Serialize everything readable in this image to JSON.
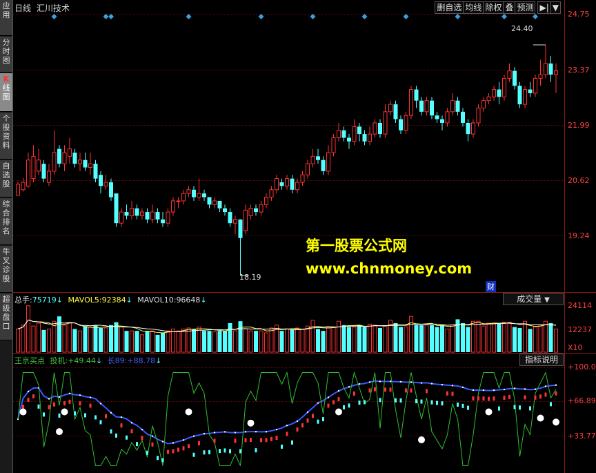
{
  "sidebar": {
    "items": [
      {
        "label": "应用"
      },
      {
        "label": "分时图"
      },
      {
        "label_k": "K",
        "label": "线图"
      },
      {
        "label": "个股资料"
      },
      {
        "label": "自选股"
      },
      {
        "label": "综合排名"
      },
      {
        "label": "牛叉诊股"
      },
      {
        "label": "超级盘口"
      }
    ]
  },
  "topbar": {
    "period": "日线",
    "indicator": "汇川技术",
    "buttons": [
      "删自选",
      "均线",
      "除权",
      "叠",
      "预测"
    ],
    "nav_icon": "▶|",
    "dropdown_icon": "▼"
  },
  "price_axis": {
    "labels": [
      "24.75",
      "23.37",
      "21.99",
      "20.62",
      "19.24"
    ]
  },
  "annotations": {
    "high": "24.40",
    "low": "18.19",
    "finance_badge": "财"
  },
  "watermark": {
    "line1": "第一股票公式网",
    "line2": "www.chnmoney.com"
  },
  "volume": {
    "label_total": "总手:",
    "total": "75719",
    "label_ma5": "MAVOL5:",
    "ma5": "92384",
    "label_ma10": "MAVOL10:",
    "ma10": "96648",
    "arrow": "↓",
    "selector": "成交量",
    "axis": [
      "24114",
      "12237"
    ],
    "multiplier": "X10"
  },
  "indicator": {
    "name": "王京买点",
    "label_tj": "投机:",
    "tj": "+49.44",
    "label_ch": "长89:",
    "ch": "+88.78",
    "arrow": "↓",
    "help_button": "指标说明",
    "axis": [
      "+100.0",
      "+66.89",
      "+33.77"
    ]
  },
  "colors": {
    "up": "#ff3232",
    "down": "#54ffff",
    "axis": "#ff4040",
    "watermark": "#ffff00",
    "marker": "#3aa0d8"
  },
  "chart_data": {
    "type": "candlestick",
    "ylim": [
      17.8,
      25.2
    ],
    "candles_ohlc": [
      [
        20.35,
        20.65,
        20.55,
        20.72
      ],
      [
        20.5,
        20.7,
        20.45,
        20.82
      ],
      [
        20.6,
        21.3,
        20.55,
        21.5
      ],
      [
        20.8,
        21.4,
        20.7,
        21.7
      ],
      [
        21.0,
        21.3,
        20.9,
        21.6
      ],
      [
        21.2,
        20.8,
        20.7,
        21.3
      ],
      [
        20.7,
        21.0,
        20.6,
        21.2
      ],
      [
        21.0,
        21.5,
        20.9,
        22.1
      ],
      [
        21.6,
        21.2,
        21.1,
        21.7
      ],
      [
        21.2,
        21.5,
        21.0,
        21.7
      ],
      [
        21.4,
        21.6,
        21.2,
        21.9
      ],
      [
        21.5,
        21.2,
        21.1,
        21.6
      ],
      [
        21.2,
        21.3,
        21.0,
        21.5
      ],
      [
        21.3,
        21.1,
        21.0,
        21.5
      ],
      [
        21.1,
        21.2,
        20.9,
        21.5
      ],
      [
        21.2,
        20.8,
        20.7,
        21.3
      ],
      [
        20.9,
        20.6,
        20.4,
        21.0
      ],
      [
        20.6,
        20.7,
        20.5,
        20.9
      ],
      [
        20.7,
        20.3,
        20.2,
        20.8
      ],
      [
        20.4,
        19.6,
        19.5,
        20.4
      ],
      [
        19.6,
        19.9,
        19.5,
        20.0
      ],
      [
        19.9,
        19.8,
        19.7,
        20.1
      ],
      [
        19.8,
        20.0,
        19.7,
        20.2
      ],
      [
        20.0,
        19.8,
        19.7,
        20.1
      ],
      [
        19.8,
        19.9,
        19.7,
        20.0
      ],
      [
        19.9,
        19.7,
        19.6,
        20.0
      ],
      [
        19.7,
        19.9,
        19.6,
        20.1
      ],
      [
        19.9,
        19.7,
        19.6,
        20.0
      ],
      [
        19.7,
        19.6,
        19.5,
        19.9
      ],
      [
        19.6,
        19.9,
        19.5,
        20.0
      ],
      [
        19.9,
        20.2,
        19.8,
        20.3
      ],
      [
        20.2,
        20.2,
        20.0,
        20.3
      ],
      [
        20.2,
        20.4,
        20.1,
        20.5
      ],
      [
        20.4,
        20.5,
        20.3,
        20.6
      ],
      [
        20.5,
        20.3,
        20.2,
        20.6
      ],
      [
        20.3,
        20.4,
        20.2,
        20.8
      ],
      [
        20.4,
        20.3,
        20.2,
        20.5
      ],
      [
        20.3,
        20.1,
        20.0,
        20.3
      ],
      [
        20.1,
        20.2,
        20.0,
        20.3
      ],
      [
        20.2,
        20.0,
        19.9,
        20.2
      ],
      [
        20.0,
        19.9,
        19.8,
        20.1
      ],
      [
        19.9,
        19.6,
        19.5,
        20.0
      ],
      [
        19.6,
        19.7,
        19.3,
        19.8
      ],
      [
        19.7,
        19.2,
        18.19,
        19.7
      ],
      [
        19.4,
        19.95,
        19.3,
        20.1
      ],
      [
        19.8,
        20.0,
        19.7,
        20.1
      ],
      [
        20.0,
        19.9,
        19.8,
        20.1
      ],
      [
        19.9,
        20.1,
        19.8,
        20.2
      ],
      [
        20.1,
        20.3,
        20.0,
        20.4
      ],
      [
        20.3,
        20.5,
        20.2,
        20.6
      ],
      [
        20.5,
        20.8,
        20.4,
        20.9
      ],
      [
        20.7,
        20.6,
        20.5,
        20.8
      ],
      [
        20.6,
        20.8,
        20.5,
        20.9
      ],
      [
        20.8,
        20.5,
        20.4,
        20.9
      ],
      [
        20.5,
        20.7,
        20.4,
        20.8
      ],
      [
        20.7,
        20.9,
        20.6,
        21.0
      ],
      [
        20.9,
        21.2,
        20.8,
        21.3
      ],
      [
        21.2,
        21.4,
        21.1,
        21.6
      ],
      [
        21.4,
        21.3,
        21.2,
        21.6
      ],
      [
        21.3,
        21.0,
        20.9,
        21.4
      ],
      [
        21.0,
        21.5,
        20.9,
        21.7
      ],
      [
        21.5,
        21.9,
        21.4,
        22.0
      ],
      [
        21.9,
        22.1,
        21.8,
        22.3
      ],
      [
        22.1,
        21.9,
        21.8,
        22.2
      ],
      [
        21.9,
        21.8,
        21.6,
        22.0
      ],
      [
        21.8,
        22.2,
        21.7,
        22.4
      ],
      [
        22.2,
        22.0,
        21.8,
        22.3
      ],
      [
        22.0,
        21.8,
        21.7,
        22.1
      ],
      [
        21.8,
        22.0,
        21.7,
        22.2
      ],
      [
        22.0,
        22.3,
        21.9,
        22.4
      ],
      [
        22.3,
        22.0,
        21.9,
        22.4
      ],
      [
        22.0,
        22.6,
        21.9,
        22.8
      ],
      [
        22.6,
        22.8,
        22.5,
        22.9
      ],
      [
        22.8,
        22.4,
        22.3,
        22.9
      ],
      [
        22.4,
        22.1,
        22.0,
        22.5
      ],
      [
        22.1,
        22.5,
        22.0,
        22.6
      ],
      [
        22.5,
        23.2,
        22.4,
        23.3
      ],
      [
        23.2,
        22.9,
        22.7,
        23.3
      ],
      [
        22.9,
        22.6,
        22.5,
        23.0
      ],
      [
        22.6,
        22.9,
        22.5,
        23.0
      ],
      [
        22.9,
        22.5,
        22.4,
        23.0
      ],
      [
        22.5,
        22.4,
        22.3,
        22.6
      ],
      [
        22.4,
        22.3,
        22.1,
        22.5
      ],
      [
        22.3,
        22.6,
        22.2,
        22.7
      ],
      [
        22.6,
        22.9,
        22.5,
        23.1
      ],
      [
        22.9,
        22.6,
        22.5,
        23.0
      ],
      [
        22.6,
        22.3,
        22.2,
        22.7
      ],
      [
        22.3,
        22.0,
        21.8,
        22.4
      ],
      [
        22.0,
        22.3,
        21.9,
        22.4
      ],
      [
        22.3,
        22.7,
        22.2,
        22.8
      ],
      [
        22.7,
        22.9,
        22.6,
        23.0
      ],
      [
        22.9,
        23.0,
        22.8,
        23.1
      ],
      [
        23.0,
        23.2,
        22.9,
        23.3
      ],
      [
        23.2,
        23.0,
        22.8,
        23.4
      ],
      [
        23.0,
        23.5,
        22.9,
        23.6
      ],
      [
        23.5,
        23.7,
        23.4,
        23.9
      ],
      [
        23.7,
        23.3,
        23.2,
        23.8
      ],
      [
        23.3,
        22.8,
        22.7,
        23.4
      ],
      [
        22.8,
        23.2,
        22.7,
        23.3
      ],
      [
        23.2,
        23.1,
        23.0,
        23.4
      ],
      [
        23.1,
        23.5,
        23.0,
        23.6
      ],
      [
        23.5,
        23.6,
        23.3,
        24.0
      ],
      [
        23.6,
        23.9,
        23.5,
        24.4
      ],
      [
        23.9,
        23.6,
        23.4,
        24.1
      ],
      [
        23.6,
        23.7,
        23.1,
        23.9
      ]
    ],
    "volume_values": [
      120,
      140,
      240,
      135,
      150,
      115,
      120,
      160,
      185,
      140,
      150,
      120,
      110,
      135,
      130,
      140,
      125,
      125,
      140,
      155,
      130,
      110,
      110,
      110,
      90,
      110,
      110,
      90,
      100,
      110,
      120,
      110,
      120,
      125,
      120,
      130,
      110,
      110,
      105,
      110,
      110,
      150,
      110,
      160,
      120,
      110,
      110,
      110,
      100,
      125,
      140,
      110,
      120,
      115,
      125,
      120,
      135,
      165,
      120,
      110,
      130,
      130,
      160,
      140,
      130,
      130,
      140,
      130,
      145,
      140,
      125,
      135,
      165,
      150,
      130,
      130,
      185,
      140,
      140,
      140,
      140,
      130,
      140,
      120,
      140,
      170,
      150,
      130,
      160,
      160,
      135,
      150,
      150,
      150,
      155,
      155,
      130,
      125,
      160,
      120,
      130,
      140,
      160,
      150,
      120
    ],
    "indicator_range": [
      0,
      100
    ]
  }
}
